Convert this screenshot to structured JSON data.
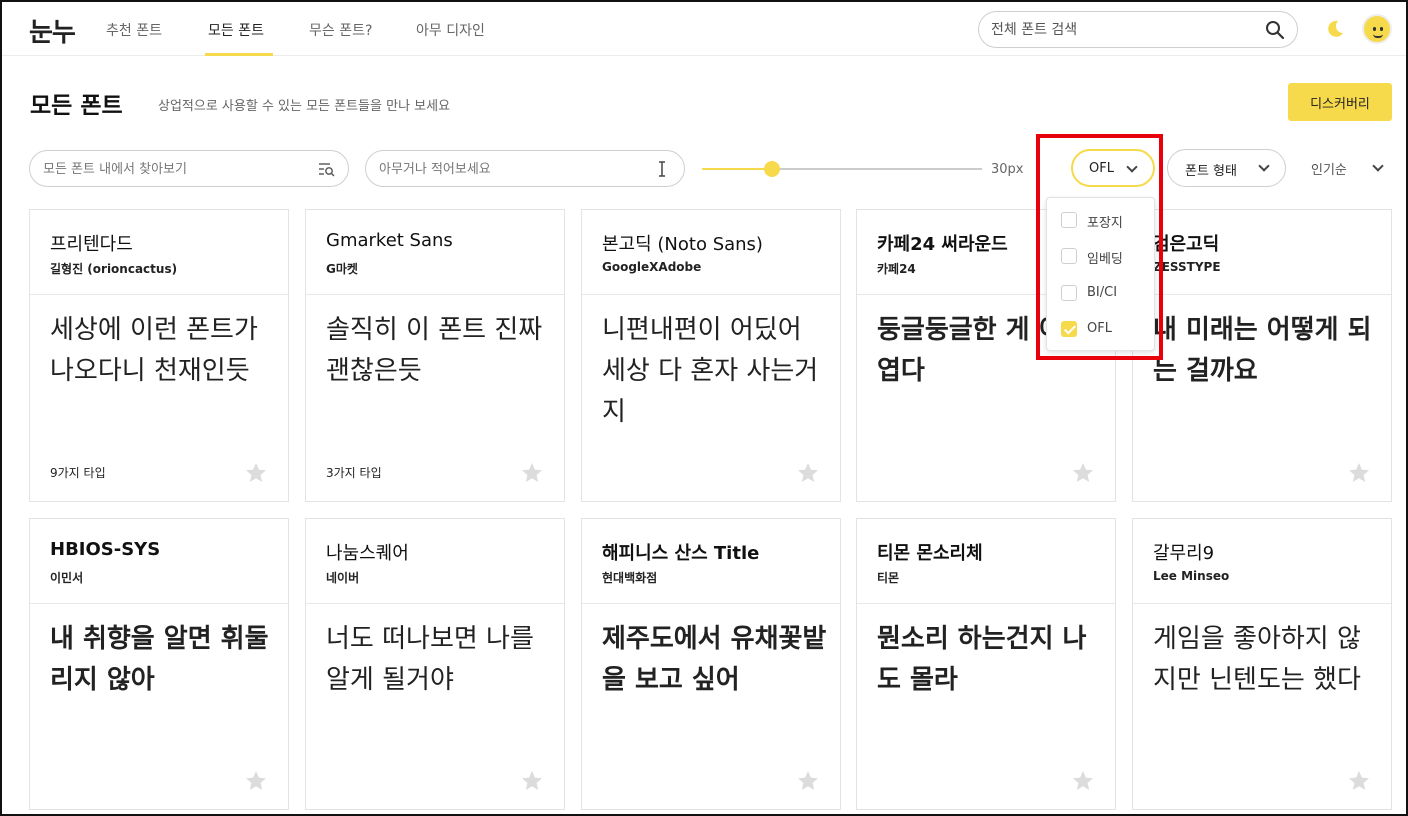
{
  "header": {
    "logo": "눈누",
    "nav": [
      "추천 폰트",
      "모든 폰트",
      "무슨 폰트?",
      "아무 디자인"
    ],
    "search_placeholder": "전체 폰트 검색"
  },
  "page": {
    "title": "모든 폰트",
    "subtitle": "상업적으로 사용할 수 있는 모든 폰트들을 만나 보세요",
    "discover_label": "디스커버리"
  },
  "filters": {
    "find_placeholder": "모든 폰트 내에서 찾아보기",
    "preview_placeholder": "아무거나 적어보세요",
    "size_label": "30px",
    "size_value_fraction": 0.25,
    "license_label": "OFL",
    "type_label": "폰트 형태",
    "sort_label": "인기순"
  },
  "license_menu": [
    {
      "label": "포장지",
      "checked": false
    },
    {
      "label": "임베딩",
      "checked": false
    },
    {
      "label": "BI/CI",
      "checked": false
    },
    {
      "label": "OFL",
      "checked": true
    }
  ],
  "fonts": [
    {
      "name": "프리텐다드",
      "maker": "길형진 (orioncactus)",
      "sample": "세상에 이런 폰트가 나오다니 천재인듯",
      "types": "9가지 타입"
    },
    {
      "name": "Gmarket Sans",
      "maker": "G마켓",
      "sample": "솔직히 이 폰트 진짜 괜찮은듯",
      "types": "3가지 타입"
    },
    {
      "name": "본고딕 (Noto Sans)",
      "maker": "GoogleXAdobe",
      "sample": "니편내편이 어딨어 세상 다 혼자 사는거지",
      "types": ""
    },
    {
      "name": "카페24 써라운드",
      "maker": "카페24",
      "sample": "둥글둥글한 게 이 귀엽다",
      "types": ""
    },
    {
      "name": "검은고딕",
      "maker": "ZESSTYPE",
      "sample": "내 미래는 어떻게 되는 걸까요",
      "types": ""
    },
    {
      "name": "HBIOS-SYS",
      "maker": "이민서",
      "sample": "내 취향을 알면 휘둘리지 않아",
      "types": ""
    },
    {
      "name": "나눔스퀘어",
      "maker": "네이버",
      "sample": "너도 떠나보면 나를 알게 될거야",
      "types": ""
    },
    {
      "name": "해피니스 산스 Title",
      "maker": "현대백화점",
      "sample": "제주도에서 유채꽃밭을 보고 싶어",
      "types": ""
    },
    {
      "name": "티몬 몬소리체",
      "maker": "티몬",
      "sample": "뭔소리 하는건지 나도 몰라",
      "types": ""
    },
    {
      "name": "갈무리9",
      "maker": "Lee Minseo",
      "sample": "게임을 좋아하지 않지만 닌텐도는 했다",
      "types": ""
    }
  ],
  "colors": {
    "accent": "#f7d94c",
    "annotation_box": "#e8000b"
  }
}
